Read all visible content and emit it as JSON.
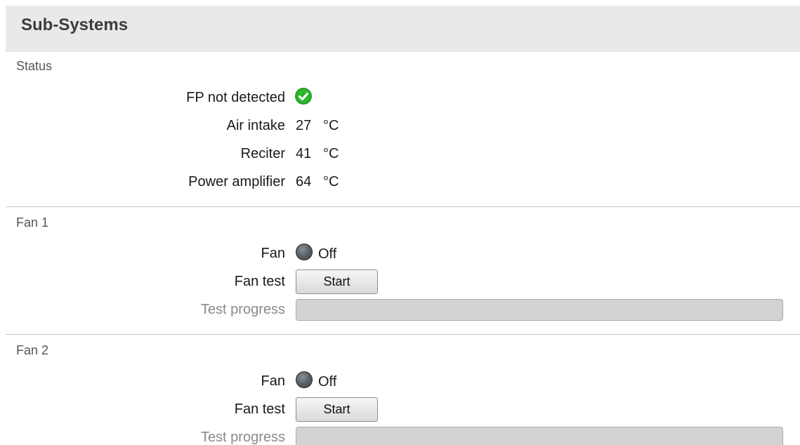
{
  "header": {
    "title": "Sub-Systems"
  },
  "status": {
    "title": "Status",
    "fp": {
      "label": "FP not detected",
      "icon": "check-circle-icon",
      "color": "#2fb52f"
    },
    "air_intake": {
      "label": "Air intake",
      "value": "27",
      "unit": "°C"
    },
    "reciter": {
      "label": "Reciter",
      "value": "41",
      "unit": "°C"
    },
    "power_amplifier": {
      "label": "Power amplifier",
      "value": "64",
      "unit": "°C"
    }
  },
  "fans": [
    {
      "title": "Fan 1",
      "fan_label": "Fan",
      "state": "Off",
      "state_icon": "led-off-icon",
      "test_label": "Fan test",
      "button_label": "Start",
      "progress_label": "Test progress",
      "progress": 0
    },
    {
      "title": "Fan 2",
      "fan_label": "Fan",
      "state": "Off",
      "state_icon": "led-off-icon",
      "test_label": "Fan test",
      "button_label": "Start",
      "progress_label": "Test progress",
      "progress": 0
    }
  ]
}
